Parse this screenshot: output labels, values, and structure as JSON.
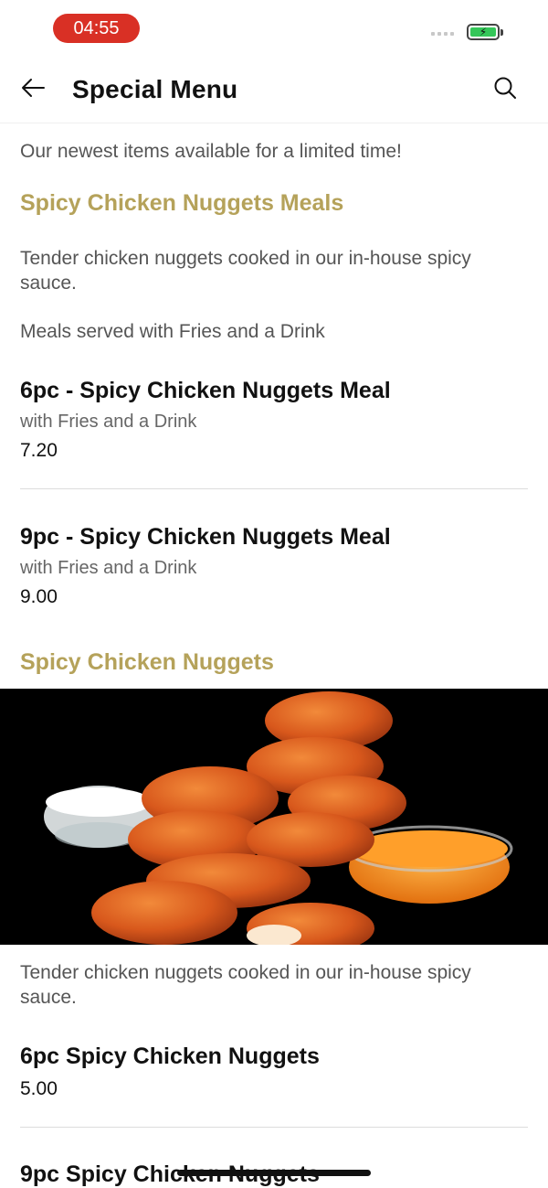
{
  "status": {
    "time": "04:55"
  },
  "header": {
    "title": "Special Menu"
  },
  "intro": "Our newest items available for a limited time!",
  "section1": {
    "title": "Spicy Chicken Nuggets Meals",
    "description": "Tender chicken nuggets cooked in our in-house spicy sauce.",
    "note": "Meals served with Fries and a Drink",
    "items": [
      {
        "name": "6pc - Spicy Chicken Nuggets Meal",
        "sub": "with Fries and a Drink",
        "price": "7.20"
      },
      {
        "name": "9pc - Spicy Chicken Nuggets Meal",
        "sub": "with Fries and a Drink",
        "price": "9.00"
      }
    ]
  },
  "section2": {
    "title": "Spicy Chicken Nuggets",
    "description": "Tender chicken nuggets cooked in our in-house spicy sauce.",
    "items": [
      {
        "name": "6pc Spicy Chicken Nuggets",
        "price": "5.00"
      },
      {
        "name": "9pc Spicy Chicken Nuggets"
      }
    ]
  },
  "colors": {
    "accent": "#b5a25a",
    "status_pill": "#d93025",
    "battery": "#34c759"
  },
  "icons": {
    "back": "arrow-left-icon",
    "search": "search-icon"
  }
}
